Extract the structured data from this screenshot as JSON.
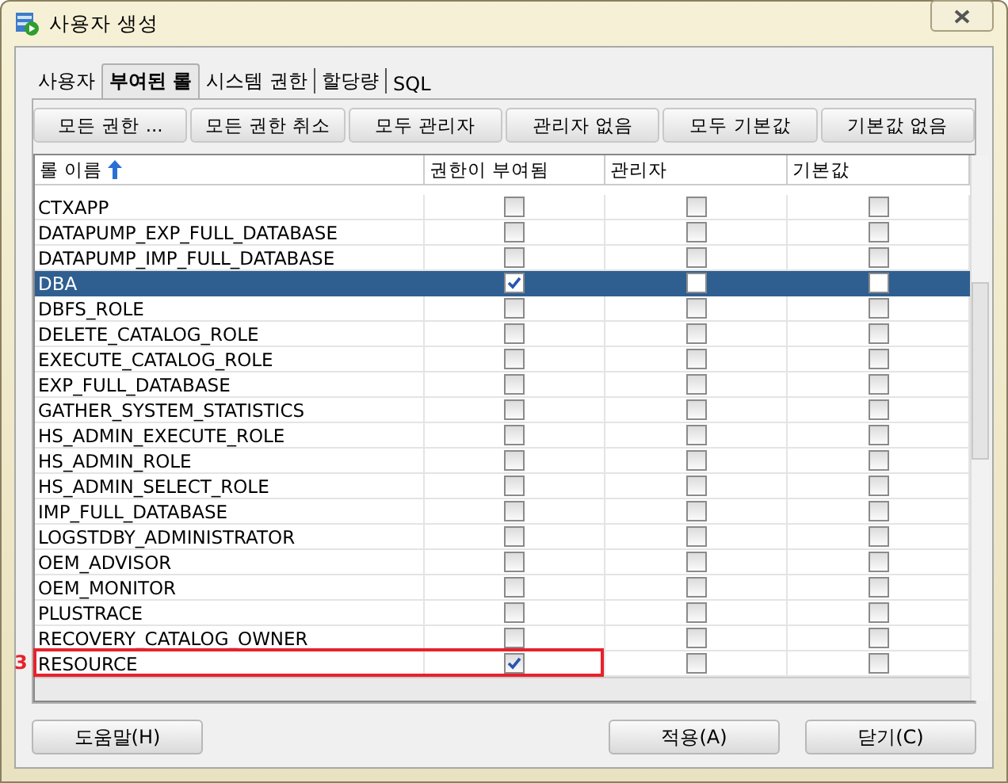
{
  "window": {
    "title": "사용자 생성"
  },
  "tabs": [
    {
      "label": "사용자",
      "selected": false
    },
    {
      "label": "부여된 롤",
      "selected": true
    },
    {
      "label": "시스템 권한",
      "selected": false
    },
    {
      "label": "할당량",
      "selected": false
    },
    {
      "label": "SQL",
      "selected": false
    }
  ],
  "toolbar": [
    "모든 권한 ...",
    "모든 권한 취소",
    "모두 관리자",
    "관리자 없음",
    "모두 기본값",
    "기본값 없음"
  ],
  "table": {
    "columns": [
      {
        "label": "롤 이름",
        "sorted": true
      },
      {
        "label": "권한이 부여됨",
        "sorted": false
      },
      {
        "label": "관리자",
        "sorted": false
      },
      {
        "label": "기본값",
        "sorted": false
      }
    ],
    "rows": [
      {
        "name": "CTXAPP",
        "granted": false,
        "admin": false,
        "default": false,
        "selected": false
      },
      {
        "name": "DATAPUMP_EXP_FULL_DATABASE",
        "granted": false,
        "admin": false,
        "default": false,
        "selected": false
      },
      {
        "name": "DATAPUMP_IMP_FULL_DATABASE",
        "granted": false,
        "admin": false,
        "default": false,
        "selected": false
      },
      {
        "name": "DBA",
        "granted": true,
        "admin": false,
        "default": false,
        "selected": true
      },
      {
        "name": "DBFS_ROLE",
        "granted": false,
        "admin": false,
        "default": false,
        "selected": false
      },
      {
        "name": "DELETE_CATALOG_ROLE",
        "granted": false,
        "admin": false,
        "default": false,
        "selected": false
      },
      {
        "name": "EXECUTE_CATALOG_ROLE",
        "granted": false,
        "admin": false,
        "default": false,
        "selected": false
      },
      {
        "name": "EXP_FULL_DATABASE",
        "granted": false,
        "admin": false,
        "default": false,
        "selected": false
      },
      {
        "name": "GATHER_SYSTEM_STATISTICS",
        "granted": false,
        "admin": false,
        "default": false,
        "selected": false
      },
      {
        "name": "HS_ADMIN_EXECUTE_ROLE",
        "granted": false,
        "admin": false,
        "default": false,
        "selected": false
      },
      {
        "name": "HS_ADMIN_ROLE",
        "granted": false,
        "admin": false,
        "default": false,
        "selected": false
      },
      {
        "name": "HS_ADMIN_SELECT_ROLE",
        "granted": false,
        "admin": false,
        "default": false,
        "selected": false
      },
      {
        "name": "IMP_FULL_DATABASE",
        "granted": false,
        "admin": false,
        "default": false,
        "selected": false
      },
      {
        "name": "LOGSTDBY_ADMINISTRATOR",
        "granted": false,
        "admin": false,
        "default": false,
        "selected": false
      },
      {
        "name": "OEM_ADVISOR",
        "granted": false,
        "admin": false,
        "default": false,
        "selected": false
      },
      {
        "name": "OEM_MONITOR",
        "granted": false,
        "admin": false,
        "default": false,
        "selected": false
      },
      {
        "name": "PLUSTRACE",
        "granted": false,
        "admin": false,
        "default": false,
        "selected": false
      },
      {
        "name": "RECOVERY_CATALOG_OWNER",
        "granted": false,
        "admin": false,
        "default": false,
        "selected": false
      },
      {
        "name": "RESOURCE",
        "granted": true,
        "admin": false,
        "default": false,
        "selected": false,
        "highlighted": true
      }
    ]
  },
  "annotation": {
    "label": "3"
  },
  "buttons": [
    {
      "label": "도움말(H)",
      "kind": "left"
    },
    {
      "label": "적용(A)",
      "kind": "right"
    },
    {
      "label": "닫기(C)",
      "kind": "right"
    }
  ]
}
